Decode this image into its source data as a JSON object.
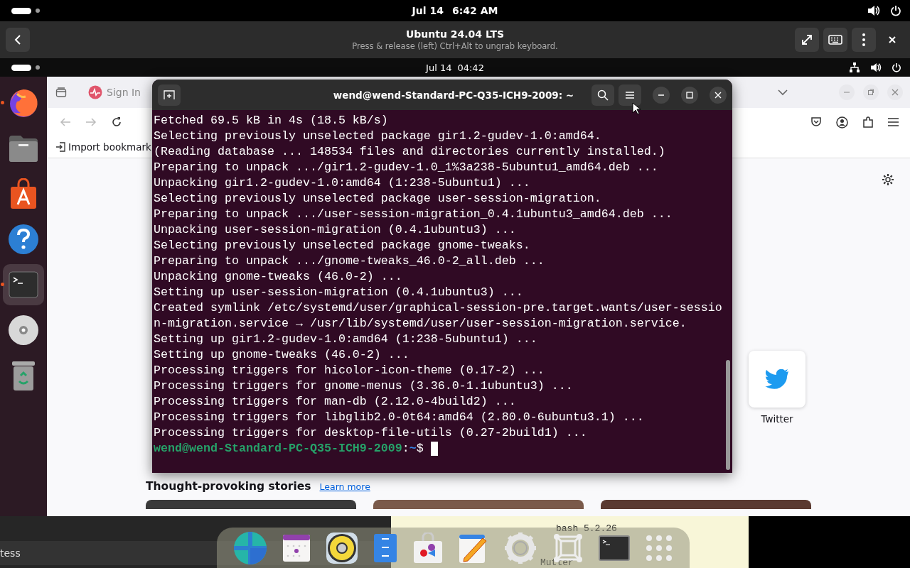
{
  "host_bar": {
    "date": "Jul 14",
    "time": "6:42 AM"
  },
  "vm_header": {
    "title": "Ubuntu 24.04 LTS",
    "subtitle": "Press & release (left) Ctrl+Alt to ungrab keyboard."
  },
  "guest_bar": {
    "date": "Jul 14",
    "time": "04:42"
  },
  "dock": {
    "apps": [
      {
        "kind": "firefox",
        "running": true,
        "selected": false
      },
      {
        "kind": "files",
        "running": false,
        "selected": false
      },
      {
        "kind": "app-center",
        "running": false,
        "selected": false
      },
      {
        "kind": "help",
        "running": false,
        "selected": false
      },
      {
        "kind": "terminal",
        "running": true,
        "selected": true
      },
      {
        "kind": "disc",
        "running": false,
        "selected": false
      },
      {
        "kind": "trash",
        "running": false,
        "selected": false
      }
    ]
  },
  "browser": {
    "tab": {
      "label": "Sign In"
    },
    "bookmarks": [
      {
        "label": "Import bookmark"
      }
    ],
    "shortcuts": [
      {
        "label": "Twitter"
      }
    ],
    "stories": {
      "heading": "Thought-provoking stories",
      "link": "Learn more"
    }
  },
  "terminal": {
    "title": "wend@wend-Standard-PC-Q35-ICH9-2009: ~",
    "lines": [
      "Fetched 69.5 kB in 4s (18.5 kB/s)",
      "Selecting previously unselected package gir1.2-gudev-1.0:amd64.",
      "(Reading database ... 148534 files and directories currently installed.)",
      "Preparing to unpack .../gir1.2-gudev-1.0_1%3a238-5ubuntu1_amd64.deb ...",
      "Unpacking gir1.2-gudev-1.0:amd64 (1:238-5ubuntu1) ...",
      "Selecting previously unselected package user-session-migration.",
      "Preparing to unpack .../user-session-migration_0.4.1ubuntu3_amd64.deb ...",
      "Unpacking user-session-migration (0.4.1ubuntu3) ...",
      "Selecting previously unselected package gnome-tweaks.",
      "Preparing to unpack .../gnome-tweaks_46.0-2_all.deb ...",
      "Unpacking gnome-tweaks (46.0-2) ...",
      "Setting up user-session-migration (0.4.1ubuntu3) ...",
      "Created symlink /etc/systemd/user/graphical-session-pre.target.wants/user-session-migration.service → /usr/lib/systemd/user/user-session-migration.service.",
      "Setting up gir1.2-gudev-1.0:amd64 (1:238-5ubuntu1) ...",
      "Setting up gnome-tweaks (46.0-2) ...",
      "Processing triggers for hicolor-icon-theme (0.17-2) ...",
      "Processing triggers for gnome-menus (3.36.0-1.1ubuntu3) ...",
      "Processing triggers for man-db (2.12.0-4build2) ...",
      "Processing triggers for libglib2.0-0t64:amd64 (2.80.0-6ubuntu3.1) ...",
      "Processing triggers for desktop-file-utils (0.27-2build1) ..."
    ],
    "prompt": {
      "user_host": "wend@wend-Standard-PC-Q35-ICH9-2009",
      "separator": ":",
      "path": "~",
      "symbol": "$"
    }
  },
  "taskbar": {
    "search_text": "tess",
    "apps": [
      {
        "kind": "globe"
      },
      {
        "kind": "calendar"
      },
      {
        "kind": "speaker"
      },
      {
        "kind": "cabinet"
      },
      {
        "kind": "store"
      },
      {
        "kind": "editor"
      },
      {
        "kind": "gear"
      },
      {
        "kind": "frame"
      },
      {
        "kind": "terminal"
      },
      {
        "kind": "grid"
      }
    ]
  },
  "background_window": {
    "lines": [
      "bash 5.2.26",
      "Mutter"
    ]
  }
}
